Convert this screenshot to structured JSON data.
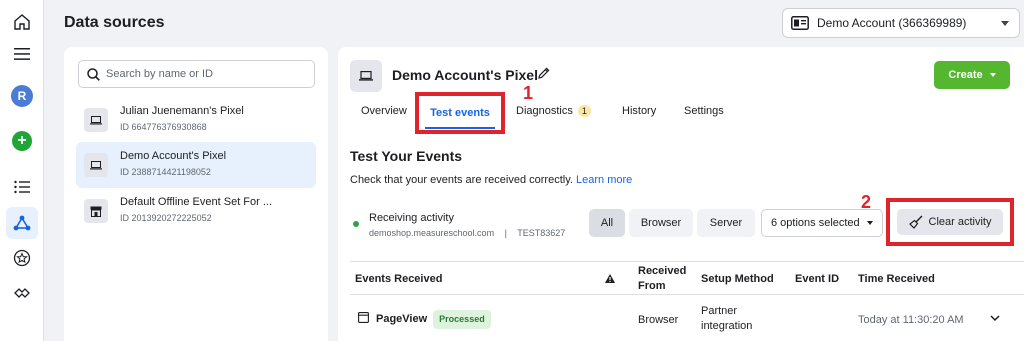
{
  "rail": {
    "icons": [
      "home-icon",
      "menu-icon",
      "avatar",
      "add-icon",
      "list-icon",
      "data-sources-icon",
      "star-icon",
      "partners-icon"
    ],
    "avatar_letter": "R"
  },
  "page_title": "Data sources",
  "account": {
    "label": "Demo Account (366369989)"
  },
  "search": {
    "placeholder": "Search by name or ID"
  },
  "sources": [
    {
      "name": "Julian Juenemann's Pixel",
      "id": "ID 664776376930868",
      "selected": false,
      "icon": "laptop-icon"
    },
    {
      "name": "Demo Account's Pixel",
      "id": "ID 2388714421198052",
      "selected": true,
      "icon": "laptop-icon"
    },
    {
      "name": "Default Offline Event Set For ...",
      "id": "ID 2013920272225052",
      "selected": false,
      "icon": "store-icon"
    }
  ],
  "pixel": {
    "title": "Demo Account's Pixel"
  },
  "create_label": "Create",
  "tabs": {
    "overview": "Overview",
    "test_events": "Test events",
    "diagnostics": "Diagnostics",
    "diagnostics_count": "1",
    "history": "History",
    "settings": "Settings"
  },
  "annotations": {
    "one": "1",
    "two": "2"
  },
  "section": {
    "title": "Test Your Events",
    "description": "Check that your events are received correctly.",
    "learn_more": "Learn more"
  },
  "receiving": {
    "title": "Receiving activity",
    "domain": "demoshop.measureschool.com",
    "separator": "|",
    "code": "TEST83627"
  },
  "filters": {
    "all": "All",
    "browser": "Browser",
    "server": "Server"
  },
  "options_label": "6 options selected",
  "clear_label": "Clear activity",
  "table": {
    "headers": {
      "events_received": "Events Received",
      "received_from_1": "Received",
      "received_from_2": "From",
      "setup_method": "Setup Method",
      "event_id": "Event ID",
      "time_received": "Time Received"
    },
    "rows": [
      {
        "event": "PageView",
        "status": "Processed",
        "received_from": "Browser",
        "setup_method_1": "Partner",
        "setup_method_2": "integration",
        "event_id": "",
        "time": "Today at 11:30:20 AM"
      }
    ]
  },
  "colors": {
    "accent_blue": "#1664e4",
    "annotation_red": "#e0242b",
    "create_green": "#55b630",
    "status_green": "#31a24c"
  }
}
